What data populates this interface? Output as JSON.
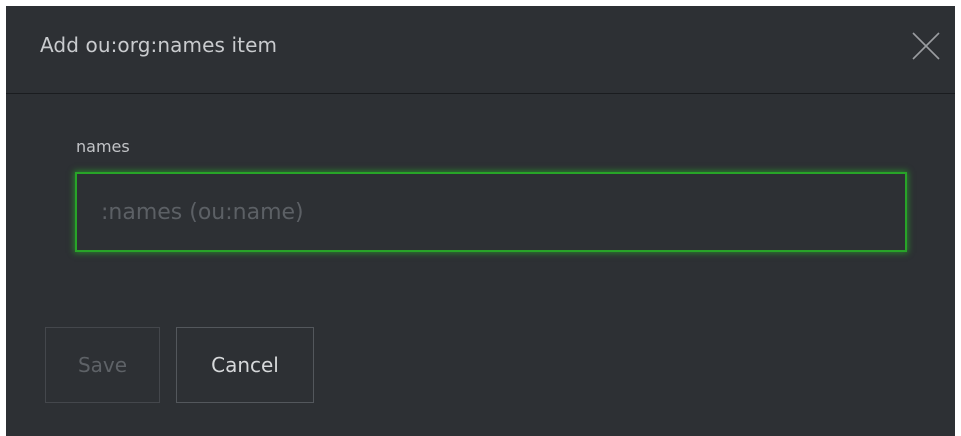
{
  "dialog": {
    "title": "Add ou:org:names item",
    "close_icon": "close-x-icon"
  },
  "form": {
    "field_label": "names",
    "input_value": "",
    "input_placeholder": ":names (ou:name)"
  },
  "actions": {
    "save_label": "Save",
    "cancel_label": "Cancel"
  },
  "colors": {
    "background": "#2d3034",
    "focus_border": "#28a428",
    "title_text": "#c9cbce"
  }
}
